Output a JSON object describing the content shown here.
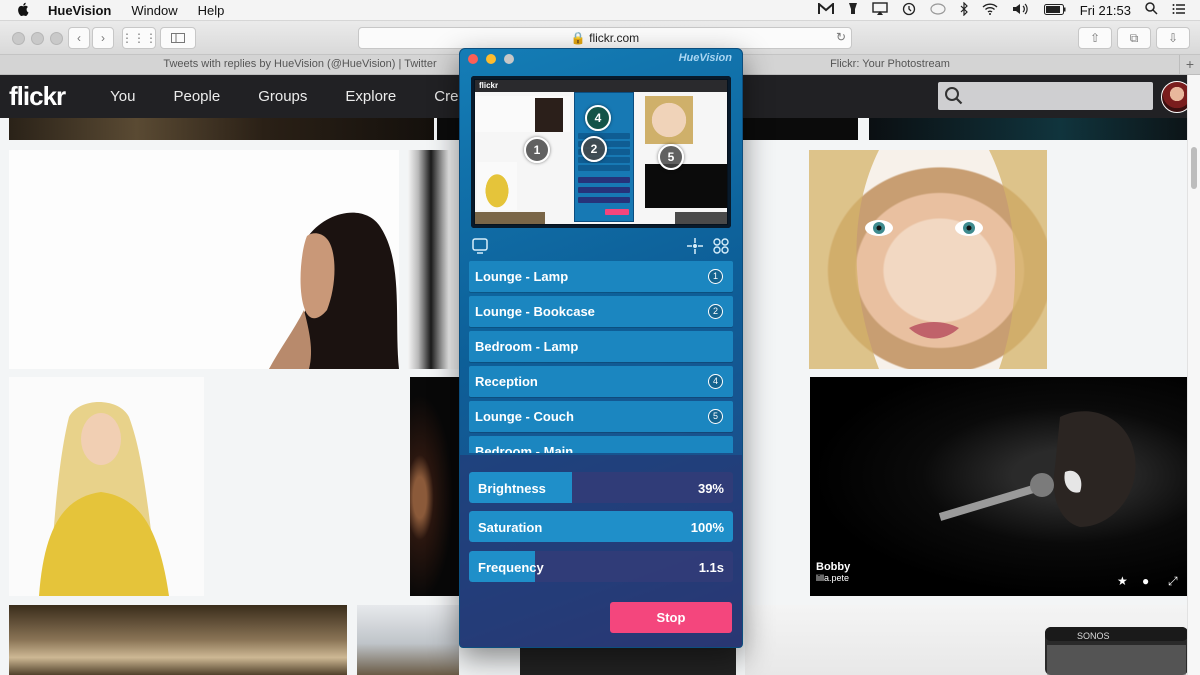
{
  "menubar": {
    "app": "HueVision",
    "items": [
      "Window",
      "Help"
    ],
    "clock": "Fri 21:53"
  },
  "browser": {
    "address": "flickr.com",
    "tabs": [
      "Tweets with replies by HueVision (@HueVision) | Twitter",
      "Flickr: Your Photostream"
    ],
    "new_tab": "+"
  },
  "flickr": {
    "logo": "flickr",
    "nav": [
      "You",
      "People",
      "Groups",
      "Explore",
      "Create"
    ],
    "photo_caption": {
      "title": "Bobby",
      "author": "lilla.pete"
    }
  },
  "hue": {
    "title": "HueVision",
    "preview_logo": "flickr",
    "markers": [
      "1",
      "2",
      "4",
      "5"
    ],
    "lights": [
      {
        "name": "Lounge - Lamp",
        "badge": "1"
      },
      {
        "name": "Lounge - Bookcase",
        "badge": "2"
      },
      {
        "name": "Bedroom - Lamp",
        "badge": ""
      },
      {
        "name": "Reception",
        "badge": "4"
      },
      {
        "name": "Lounge - Couch",
        "badge": "5"
      },
      {
        "name": "Bedroom - Main",
        "badge": ""
      }
    ],
    "sliders": {
      "brightness": {
        "label": "Brightness",
        "value": "39%",
        "level": 0.39
      },
      "saturation": {
        "label": "Saturation",
        "value": "100%",
        "level": 1.0
      },
      "frequency": {
        "label": "Frequency",
        "value": "1.1s",
        "level": 0.25
      }
    },
    "stop_label": "Stop",
    "colors": {
      "accent": "#1b86c0",
      "stop": "#f4467d"
    }
  },
  "icons": [
    "apple-icon",
    "gmail-icon",
    "airplay-icon",
    "time-machine-icon",
    "bluetooth-icon",
    "wifi-icon",
    "volume-icon",
    "battery-icon",
    "spotlight-icon",
    "notification-icon",
    "search-icon",
    "display-icon",
    "crosshair-icon",
    "grid-icon",
    "star-icon",
    "comment-icon",
    "expand-icon"
  ]
}
